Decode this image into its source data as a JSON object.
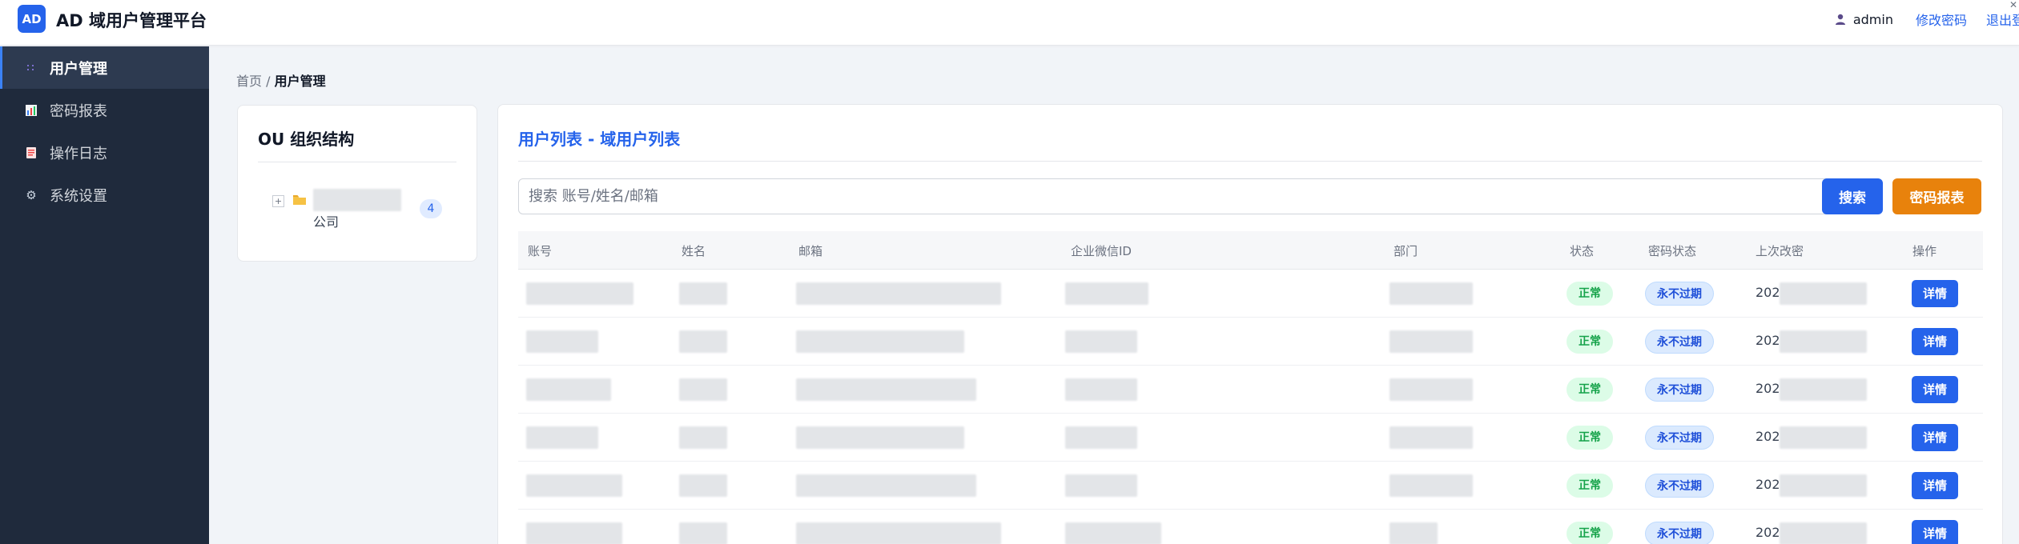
{
  "header": {
    "logo_text": "AD",
    "app_title": "AD 域用户管理平台",
    "user_name": "admin",
    "change_password": "修改密码",
    "logout": "退出登录"
  },
  "sidebar": {
    "items": [
      {
        "label": "用户管理",
        "icon": "users-icon",
        "active": true
      },
      {
        "label": "密码报表",
        "icon": "bar-chart-icon",
        "active": false
      },
      {
        "label": "操作日志",
        "icon": "document-icon",
        "active": false
      },
      {
        "label": "系统设置",
        "icon": "gear-icon",
        "active": false
      }
    ]
  },
  "breadcrumb": {
    "home": "首页",
    "separator": "/",
    "current": "用户管理"
  },
  "ou_panel": {
    "title": "OU 组织结构",
    "tree": [
      {
        "toggle": "+",
        "label_suffix": "公司",
        "count": "4"
      }
    ]
  },
  "user_list": {
    "title": "用户列表 - 域用户列表",
    "search_placeholder": "搜索 账号/姓名/邮箱",
    "search_button": "搜索",
    "report_button": "密码报表",
    "columns": [
      "账号",
      "姓名",
      "邮箱",
      "企业微信ID",
      "部门",
      "状态",
      "密码状态",
      "上次改密",
      "操作"
    ],
    "rows": [
      {
        "status": "正常",
        "password_status": "永不过期",
        "last_change_prefix": "202",
        "action": "详情"
      },
      {
        "status": "正常",
        "password_status": "永不过期",
        "last_change_prefix": "202",
        "action": "详情"
      },
      {
        "status": "正常",
        "password_status": "永不过期",
        "last_change_prefix": "202",
        "action": "详情"
      },
      {
        "status": "正常",
        "password_status": "永不过期",
        "last_change_prefix": "202",
        "action": "详情"
      },
      {
        "status": "正常",
        "password_status": "永不过期",
        "last_change_prefix": "202",
        "action": "详情"
      },
      {
        "status": "正常",
        "password_status": "永不过期",
        "last_change_prefix": "202",
        "action": "详情"
      }
    ]
  },
  "colors": {
    "primary": "#2563eb",
    "sidebar_bg": "#1f2a3c",
    "report_button": "#e8820c",
    "status_ok": "#16a34a"
  }
}
